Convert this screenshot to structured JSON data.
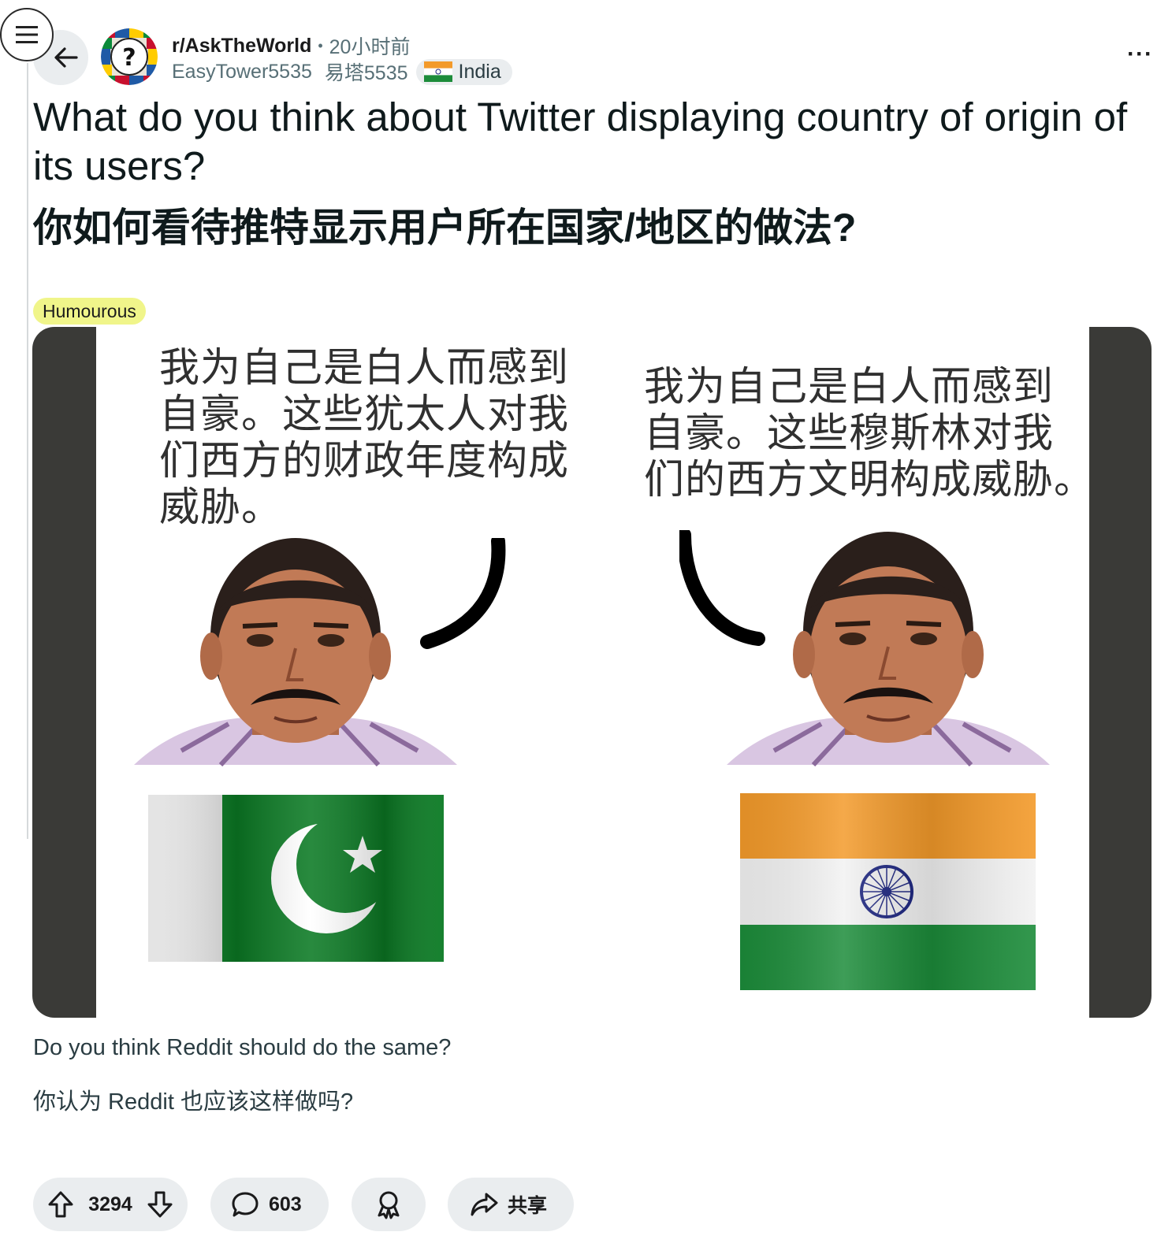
{
  "header": {
    "subreddit": "r/AskTheWorld",
    "time": "20小时前",
    "username": "EasyTower5535",
    "username_translated": "易塔5535",
    "user_flair": "India",
    "user_flair_icon": "india-flag-icon",
    "separator": "•",
    "more": "···"
  },
  "post": {
    "title_en": "What do you think about Twitter displaying country of origin of its users?",
    "title_zh": "你如何看待推特显示用户所在国家/地区的做法?",
    "tag": "Humourous",
    "body_en": "Do you think Reddit should do the same?",
    "body_zh": "你认为 Reddit 也应该这样做吗?"
  },
  "image": {
    "left_caption": [
      "我为自己是白人而感到",
      "自豪。这些犹太人对我",
      "们西方的财政年度构成",
      "威胁。"
    ],
    "right_caption": [
      "我为自己是白人而感到",
      "自豪。这些穆斯林对我",
      "们的西方文明构成威胁。"
    ],
    "left_flag": "pakistan-flag",
    "right_flag": "india-flag"
  },
  "actions": {
    "upvotes": "3294",
    "comments": "603",
    "share": "共享"
  },
  "colors": {
    "pill_bg": "#eaedef",
    "tag_bg": "#f0f58a",
    "pakistan_green": "#0b7a24",
    "india_saffron": "#f39a2a",
    "india_green": "#1c8c3a",
    "chakra_blue": "#1a237e"
  }
}
